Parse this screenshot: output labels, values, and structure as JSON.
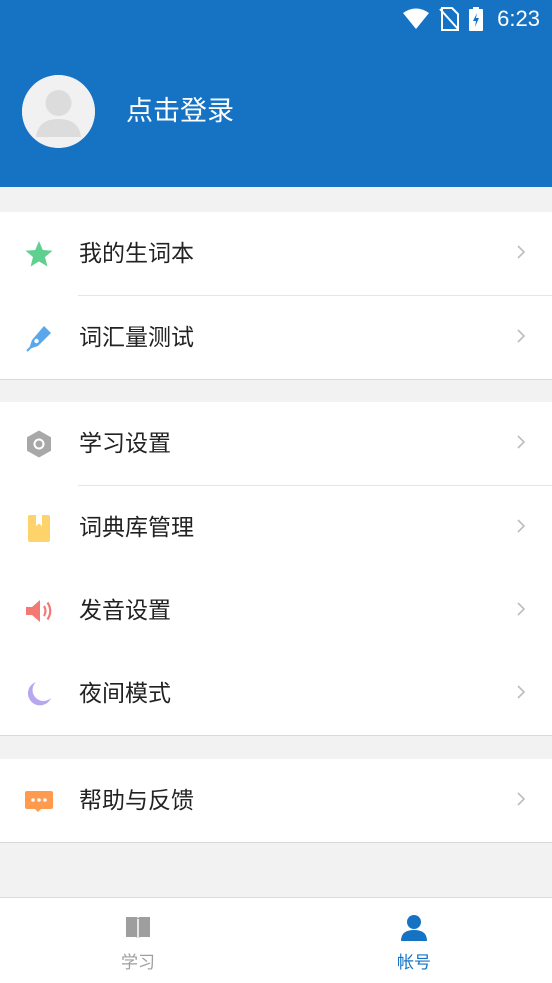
{
  "status_bar": {
    "time": "6:23"
  },
  "profile": {
    "login_text": "点击登录"
  },
  "groups": [
    {
      "items": [
        {
          "label": "我的生词本",
          "icon": "star-icon"
        },
        {
          "label": "词汇量测试",
          "icon": "pen-icon"
        }
      ]
    },
    {
      "items": [
        {
          "label": "学习设置",
          "icon": "hexagon-settings-icon"
        },
        {
          "label": "词典库管理",
          "icon": "bookmark-icon"
        },
        {
          "label": "发音设置",
          "icon": "speaker-icon"
        },
        {
          "label": "夜间模式",
          "icon": "moon-icon"
        }
      ]
    },
    {
      "items": [
        {
          "label": "帮助与反馈",
          "icon": "chat-bubble-icon"
        }
      ]
    }
  ],
  "tabbar": {
    "tabs": [
      {
        "label": "学习",
        "icon": "book-icon",
        "active": false
      },
      {
        "label": "帐号",
        "icon": "user-icon",
        "active": true
      }
    ]
  },
  "colors": {
    "brand_blue": "#1673c4",
    "star_green": "#5fd08f",
    "pen_blue": "#5aa7ec",
    "hex_gray": "#a8a8a8",
    "bookmark_yellow": "#ffd36b",
    "speaker_red": "#f27a73",
    "moon_purple": "#b7a7ef",
    "chat_orange": "#ff9a4f",
    "tab_inactive": "#9e9e9e"
  }
}
